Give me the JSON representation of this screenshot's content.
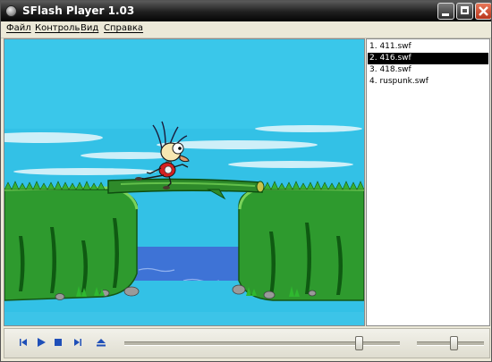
{
  "window": {
    "title": "SFlash Player 1.03"
  },
  "menu": {
    "items": [
      "Файл",
      "Контроль",
      "Вид",
      "Справка"
    ]
  },
  "playlist": {
    "items": [
      "1. 411.swf",
      "2. 416.swf",
      "3. 418.swf",
      "4. ruspunk.swf"
    ],
    "selected_index": 1
  },
  "controls": {
    "position_fraction": 0.85,
    "volume_fraction": 0.55
  },
  "colors": {
    "sky": "#33C1E6",
    "grass": "#2E9A2E",
    "water": "#3E73D6",
    "selection": "#000000",
    "control_icon": "#1F4FB8"
  },
  "icons": {
    "prev": "skip-back-icon",
    "play": "play-icon",
    "stop": "stop-icon",
    "next": "skip-forward-icon",
    "eject": "eject-icon"
  }
}
